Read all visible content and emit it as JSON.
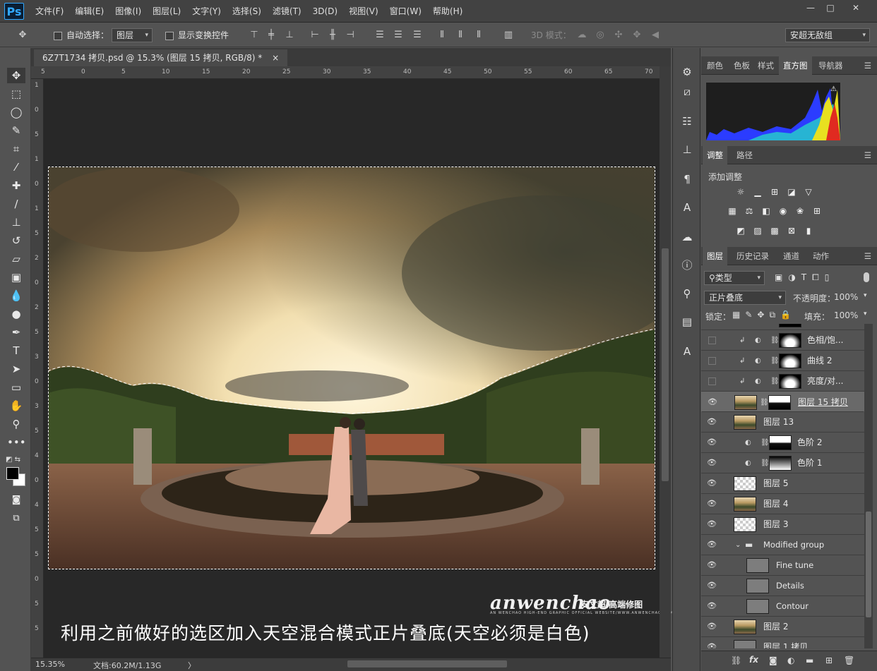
{
  "app": {
    "logo": "Ps"
  },
  "menu": [
    "文件(F)",
    "编辑(E)",
    "图像(I)",
    "图层(L)",
    "文字(Y)",
    "选择(S)",
    "滤镜(T)",
    "3D(D)",
    "视图(V)",
    "窗口(W)",
    "帮助(H)"
  ],
  "window_controls": {
    "minimize": "—",
    "restore": "□",
    "close": "✕"
  },
  "options": {
    "auto_select_label": "自动选择：",
    "auto_select_value": "图层",
    "show_transform_label": "显示变换控件",
    "mode_3d_label": "3D 模式：",
    "workspace": "安超无敌组"
  },
  "document": {
    "tab_title": "6Z7T1734 拷贝.psd @ 15.3% (图层 15 拷贝, RGB/8) *",
    "close": "×",
    "ruler_top": [
      "5",
      "0",
      "5",
      "10",
      "15",
      "20",
      "25",
      "30",
      "35",
      "40",
      "45",
      "50",
      "55",
      "60",
      "65",
      "70"
    ],
    "ruler_left": [
      "1",
      "0",
      "5",
      "1",
      "0",
      "1",
      "5",
      "2",
      "0",
      "2",
      "5",
      "3",
      "0",
      "3",
      "5",
      "4",
      "0",
      "4",
      "5",
      "5",
      "0",
      "5",
      "5"
    ],
    "caption": "利用之前做好的选区加入天空混合模式正片叠底(天空必须是白色)",
    "watermark_logo": "anwenchao",
    "watermark_cn": "安文超 高端修图",
    "watermark_sub": "AN WENCHAO HIGH-END GRAPHIC OFFICIAL WEBSITE/WWW.ANWENCHAO.COM"
  },
  "status": {
    "zoom": "15.35%",
    "doc": "文档:60.2M/1.13G",
    "arrow": "〉"
  },
  "panels": {
    "top_tabs": [
      "颜色",
      "色板",
      "样式",
      "直方图",
      "导航器"
    ],
    "top_active": "直方图",
    "adj_tabs": [
      "调整",
      "路径"
    ],
    "adj_title": "添加调整",
    "layers_tabs": [
      "图层",
      "历史记录",
      "通道",
      "动作"
    ],
    "filter_kind": "类型",
    "blend_mode": "正片叠底",
    "opacity_label": "不透明度：",
    "opacity": "100%",
    "lock_label": "锁定：",
    "fill_label": "填充：",
    "fill": "100%",
    "layers": [
      {
        "name": "亮度/对...",
        "visible": false,
        "thumb": "adj"
      },
      {
        "name": "色相/饱...",
        "visible": false,
        "thumb": "adj"
      },
      {
        "name": "曲线 2",
        "visible": false,
        "thumb": "adj"
      },
      {
        "name": "亮度/对...",
        "visible": false,
        "thumb": "adj"
      },
      {
        "name": "图层 15 拷贝",
        "visible": true,
        "thumb": "photo-mask",
        "selected": true
      },
      {
        "name": "图层 13",
        "visible": true,
        "thumb": "photo"
      },
      {
        "name": "色阶 2",
        "visible": true,
        "thumb": "adj-mask"
      },
      {
        "name": "色阶 1",
        "visible": true,
        "thumb": "adj-mask"
      },
      {
        "name": "图层 5",
        "visible": true,
        "thumb": "checker"
      },
      {
        "name": "图层 4",
        "visible": true,
        "thumb": "photo"
      },
      {
        "name": "图层 3",
        "visible": true,
        "thumb": "checker"
      },
      {
        "name": "Modified group",
        "visible": true,
        "thumb": "folder"
      },
      {
        "name": "Fine tune",
        "visible": true,
        "thumb": "gray"
      },
      {
        "name": "Details",
        "visible": true,
        "thumb": "gray"
      },
      {
        "name": "Contour",
        "visible": true,
        "thumb": "gray"
      },
      {
        "name": "图层 2",
        "visible": true,
        "thumb": "photo"
      },
      {
        "name": "图层 1 拷贝",
        "visible": true,
        "thumb": "gray"
      }
    ]
  }
}
